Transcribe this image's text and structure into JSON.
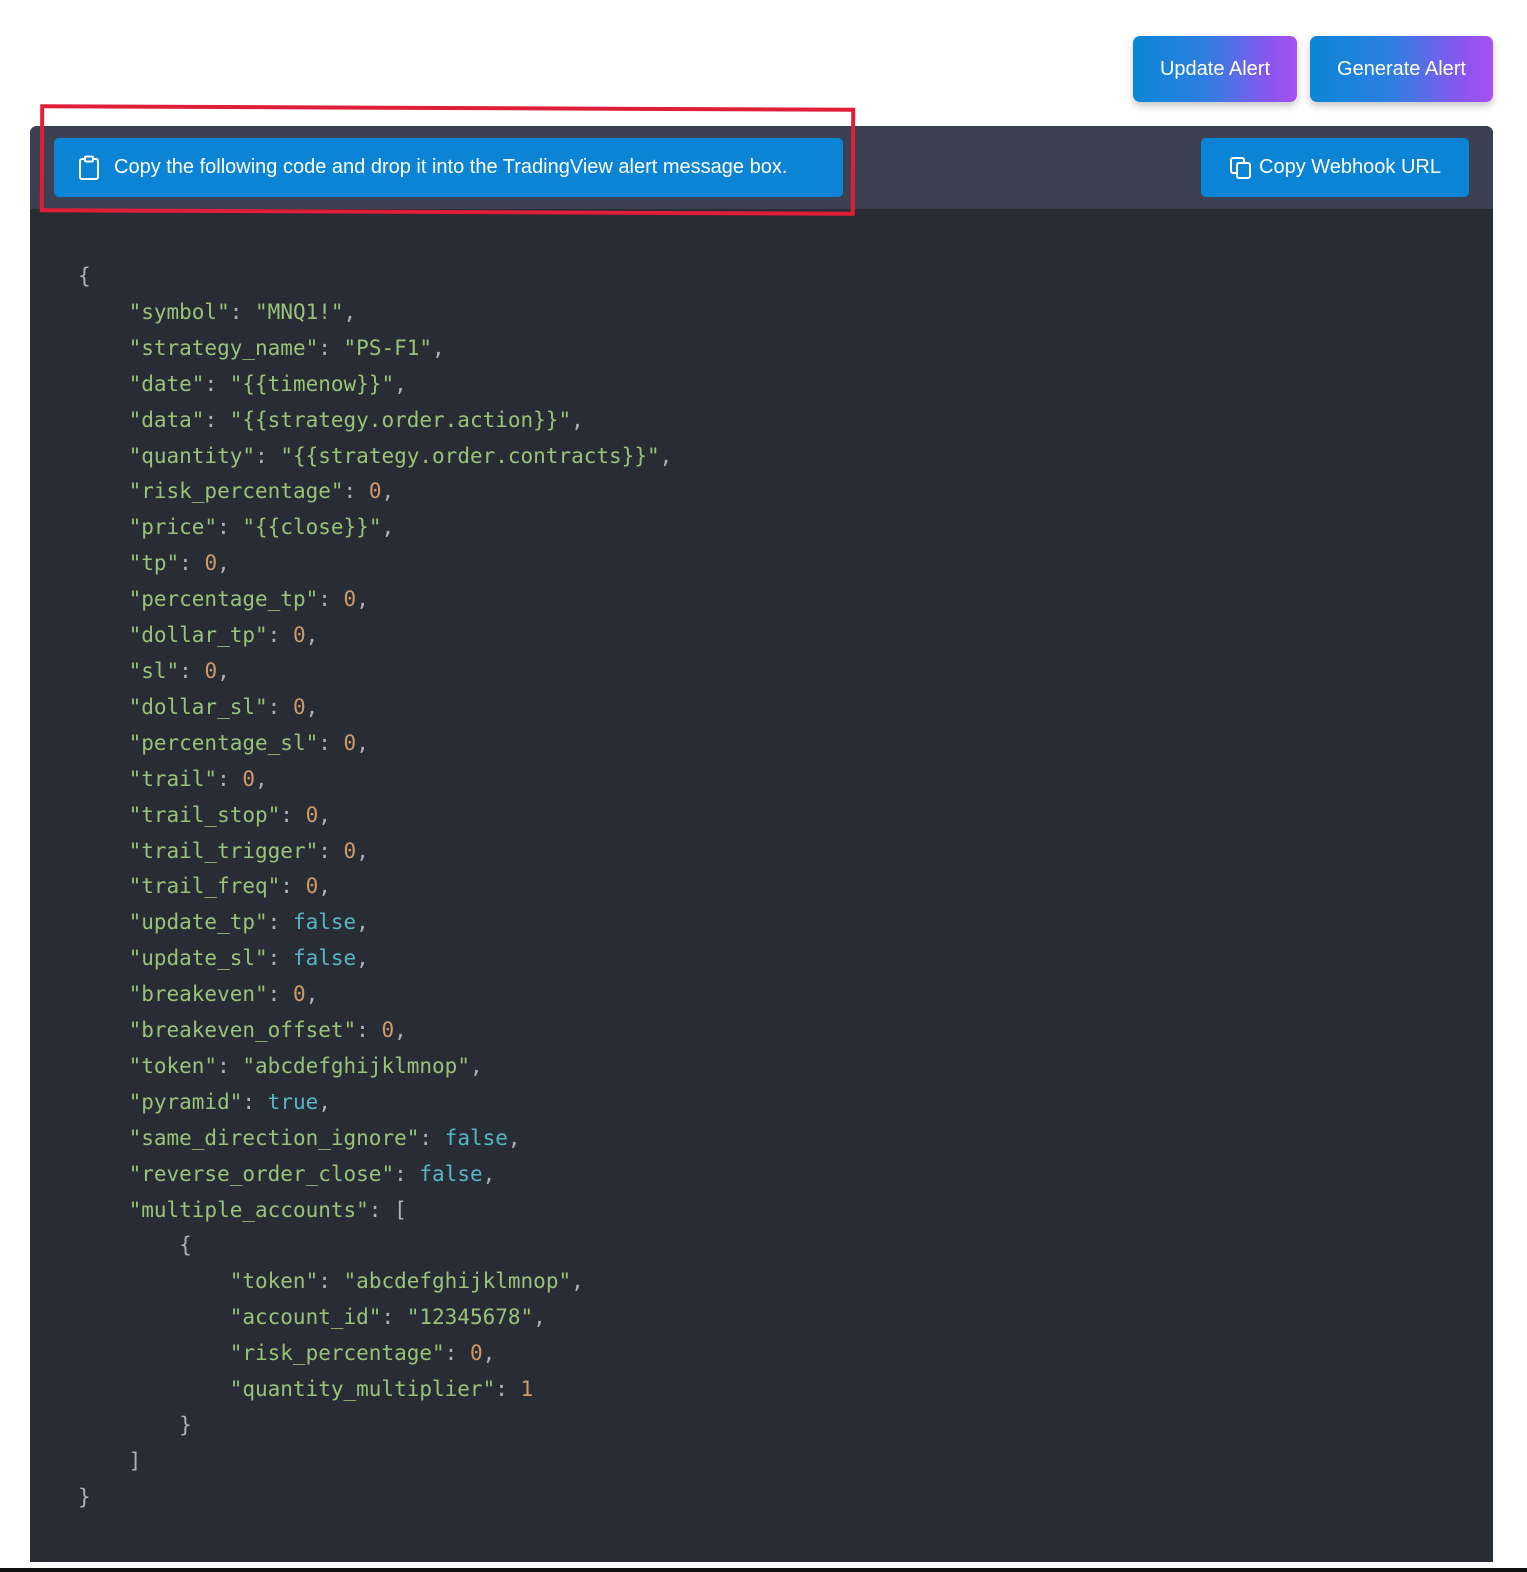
{
  "actions": {
    "update_label": "Update Alert",
    "generate_label": "Generate Alert"
  },
  "panel": {
    "banner_text": "Copy the following code and drop it into the TradingView alert message box.",
    "banner_icon": "clipboard-icon",
    "copy_webhook_label": "Copy Webhook URL",
    "copy_icon": "copy-icon"
  },
  "colors": {
    "accent_blue": "#0b84d6",
    "gradient_end": "#a653f2",
    "panel_bg": "#282c34",
    "header_bg": "#3b4150",
    "string": "#98c379",
    "number": "#d19a66",
    "boolean": "#56b6c2",
    "highlight": "#e01e37"
  },
  "code": {
    "lines": [
      [
        {
          "t": "{",
          "c": "punct"
        }
      ],
      [
        {
          "t": "    "
        },
        {
          "t": "\"symbol\"",
          "c": "key"
        },
        {
          "t": ": ",
          "c": "punct"
        },
        {
          "t": "\"MNQ1!\"",
          "c": "str"
        },
        {
          "t": ",",
          "c": "punct"
        }
      ],
      [
        {
          "t": "    "
        },
        {
          "t": "\"strategy_name\"",
          "c": "key"
        },
        {
          "t": ": ",
          "c": "punct"
        },
        {
          "t": "\"PS-F1\"",
          "c": "str"
        },
        {
          "t": ",",
          "c": "punct"
        }
      ],
      [
        {
          "t": "    "
        },
        {
          "t": "\"date\"",
          "c": "key"
        },
        {
          "t": ": ",
          "c": "punct"
        },
        {
          "t": "\"{{timenow}}\"",
          "c": "str"
        },
        {
          "t": ",",
          "c": "punct"
        }
      ],
      [
        {
          "t": "    "
        },
        {
          "t": "\"data\"",
          "c": "key"
        },
        {
          "t": ": ",
          "c": "punct"
        },
        {
          "t": "\"{{strategy.order.action}}\"",
          "c": "str"
        },
        {
          "t": ",",
          "c": "punct"
        }
      ],
      [
        {
          "t": "    "
        },
        {
          "t": "\"quantity\"",
          "c": "key"
        },
        {
          "t": ": ",
          "c": "punct"
        },
        {
          "t": "\"{{strategy.order.contracts}}\"",
          "c": "str"
        },
        {
          "t": ",",
          "c": "punct"
        }
      ],
      [
        {
          "t": "    "
        },
        {
          "t": "\"risk_percentage\"",
          "c": "key"
        },
        {
          "t": ": ",
          "c": "punct"
        },
        {
          "t": "0",
          "c": "num"
        },
        {
          "t": ",",
          "c": "punct"
        }
      ],
      [
        {
          "t": "    "
        },
        {
          "t": "\"price\"",
          "c": "key"
        },
        {
          "t": ": ",
          "c": "punct"
        },
        {
          "t": "\"{{close}}\"",
          "c": "str"
        },
        {
          "t": ",",
          "c": "punct"
        }
      ],
      [
        {
          "t": "    "
        },
        {
          "t": "\"tp\"",
          "c": "key"
        },
        {
          "t": ": ",
          "c": "punct"
        },
        {
          "t": "0",
          "c": "num"
        },
        {
          "t": ",",
          "c": "punct"
        }
      ],
      [
        {
          "t": "    "
        },
        {
          "t": "\"percentage_tp\"",
          "c": "key"
        },
        {
          "t": ": ",
          "c": "punct"
        },
        {
          "t": "0",
          "c": "num"
        },
        {
          "t": ",",
          "c": "punct"
        }
      ],
      [
        {
          "t": "    "
        },
        {
          "t": "\"dollar_tp\"",
          "c": "key"
        },
        {
          "t": ": ",
          "c": "punct"
        },
        {
          "t": "0",
          "c": "num"
        },
        {
          "t": ",",
          "c": "punct"
        }
      ],
      [
        {
          "t": "    "
        },
        {
          "t": "\"sl\"",
          "c": "key"
        },
        {
          "t": ": ",
          "c": "punct"
        },
        {
          "t": "0",
          "c": "num"
        },
        {
          "t": ",",
          "c": "punct"
        }
      ],
      [
        {
          "t": "    "
        },
        {
          "t": "\"dollar_sl\"",
          "c": "key"
        },
        {
          "t": ": ",
          "c": "punct"
        },
        {
          "t": "0",
          "c": "num"
        },
        {
          "t": ",",
          "c": "punct"
        }
      ],
      [
        {
          "t": "    "
        },
        {
          "t": "\"percentage_sl\"",
          "c": "key"
        },
        {
          "t": ": ",
          "c": "punct"
        },
        {
          "t": "0",
          "c": "num"
        },
        {
          "t": ",",
          "c": "punct"
        }
      ],
      [
        {
          "t": "    "
        },
        {
          "t": "\"trail\"",
          "c": "key"
        },
        {
          "t": ": ",
          "c": "punct"
        },
        {
          "t": "0",
          "c": "num"
        },
        {
          "t": ",",
          "c": "punct"
        }
      ],
      [
        {
          "t": "    "
        },
        {
          "t": "\"trail_stop\"",
          "c": "key"
        },
        {
          "t": ": ",
          "c": "punct"
        },
        {
          "t": "0",
          "c": "num"
        },
        {
          "t": ",",
          "c": "punct"
        }
      ],
      [
        {
          "t": "    "
        },
        {
          "t": "\"trail_trigger\"",
          "c": "key"
        },
        {
          "t": ": ",
          "c": "punct"
        },
        {
          "t": "0",
          "c": "num"
        },
        {
          "t": ",",
          "c": "punct"
        }
      ],
      [
        {
          "t": "    "
        },
        {
          "t": "\"trail_freq\"",
          "c": "key"
        },
        {
          "t": ": ",
          "c": "punct"
        },
        {
          "t": "0",
          "c": "num"
        },
        {
          "t": ",",
          "c": "punct"
        }
      ],
      [
        {
          "t": "    "
        },
        {
          "t": "\"update_tp\"",
          "c": "key"
        },
        {
          "t": ": ",
          "c": "punct"
        },
        {
          "t": "false",
          "c": "bool"
        },
        {
          "t": ",",
          "c": "punct"
        }
      ],
      [
        {
          "t": "    "
        },
        {
          "t": "\"update_sl\"",
          "c": "key"
        },
        {
          "t": ": ",
          "c": "punct"
        },
        {
          "t": "false",
          "c": "bool"
        },
        {
          "t": ",",
          "c": "punct"
        }
      ],
      [
        {
          "t": "    "
        },
        {
          "t": "\"breakeven\"",
          "c": "key"
        },
        {
          "t": ": ",
          "c": "punct"
        },
        {
          "t": "0",
          "c": "num"
        },
        {
          "t": ",",
          "c": "punct"
        }
      ],
      [
        {
          "t": "    "
        },
        {
          "t": "\"breakeven_offset\"",
          "c": "key"
        },
        {
          "t": ": ",
          "c": "punct"
        },
        {
          "t": "0",
          "c": "num"
        },
        {
          "t": ",",
          "c": "punct"
        }
      ],
      [
        {
          "t": "    "
        },
        {
          "t": "\"token\"",
          "c": "key"
        },
        {
          "t": ": ",
          "c": "punct"
        },
        {
          "t": "\"abcdefghijklmnop\"",
          "c": "str"
        },
        {
          "t": ",",
          "c": "punct"
        }
      ],
      [
        {
          "t": "    "
        },
        {
          "t": "\"pyramid\"",
          "c": "key"
        },
        {
          "t": ": ",
          "c": "punct"
        },
        {
          "t": "true",
          "c": "bool"
        },
        {
          "t": ",",
          "c": "punct"
        }
      ],
      [
        {
          "t": "    "
        },
        {
          "t": "\"same_direction_ignore\"",
          "c": "key"
        },
        {
          "t": ": ",
          "c": "punct"
        },
        {
          "t": "false",
          "c": "bool"
        },
        {
          "t": ",",
          "c": "punct"
        }
      ],
      [
        {
          "t": "    "
        },
        {
          "t": "\"reverse_order_close\"",
          "c": "key"
        },
        {
          "t": ": ",
          "c": "punct"
        },
        {
          "t": "false",
          "c": "bool"
        },
        {
          "t": ",",
          "c": "punct"
        }
      ],
      [
        {
          "t": "    "
        },
        {
          "t": "\"multiple_accounts\"",
          "c": "key"
        },
        {
          "t": ": [",
          "c": "punct"
        }
      ],
      [
        {
          "t": "        "
        },
        {
          "t": "{",
          "c": "punct"
        }
      ],
      [
        {
          "t": "            "
        },
        {
          "t": "\"token\"",
          "c": "key"
        },
        {
          "t": ": ",
          "c": "punct"
        },
        {
          "t": "\"abcdefghijklmnop\"",
          "c": "str"
        },
        {
          "t": ",",
          "c": "punct"
        }
      ],
      [
        {
          "t": "            "
        },
        {
          "t": "\"account_id\"",
          "c": "key"
        },
        {
          "t": ": ",
          "c": "punct"
        },
        {
          "t": "\"12345678\"",
          "c": "str"
        },
        {
          "t": ",",
          "c": "punct"
        }
      ],
      [
        {
          "t": "            "
        },
        {
          "t": "\"risk_percentage\"",
          "c": "key"
        },
        {
          "t": ": ",
          "c": "punct"
        },
        {
          "t": "0",
          "c": "num"
        },
        {
          "t": ",",
          "c": "punct"
        }
      ],
      [
        {
          "t": "            "
        },
        {
          "t": "\"quantity_multiplier\"",
          "c": "key"
        },
        {
          "t": ": ",
          "c": "punct"
        },
        {
          "t": "1",
          "c": "num"
        }
      ],
      [
        {
          "t": "        "
        },
        {
          "t": "}",
          "c": "punct"
        }
      ],
      [
        {
          "t": "    "
        },
        {
          "t": "]",
          "c": "punct"
        }
      ],
      [
        {
          "t": "}",
          "c": "punct"
        }
      ]
    ]
  }
}
